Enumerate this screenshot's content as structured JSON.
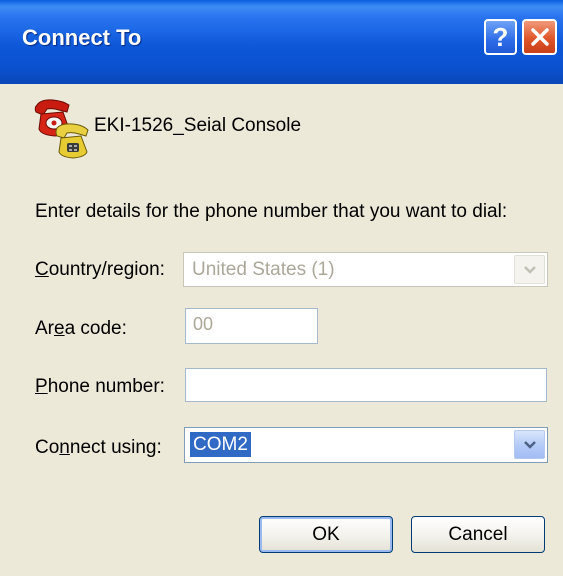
{
  "window": {
    "title": "Connect To",
    "help_glyph": "?",
    "title_icons": [
      "help-icon",
      "close-icon"
    ]
  },
  "connection": {
    "icon": "phone-icon",
    "name": "EKI-1526_Seial Console"
  },
  "instruction": "Enter details for the phone number that you want to dial:",
  "fields": {
    "country": {
      "label_prefix": "",
      "label_accel": "C",
      "label_suffix": "ountry/region:",
      "value": "United States (1)",
      "enabled": false
    },
    "area_code": {
      "label_prefix": "Ar",
      "label_accel": "e",
      "label_suffix": "a code:",
      "value": "00",
      "enabled": false
    },
    "phone_number": {
      "label_prefix": "",
      "label_accel": "P",
      "label_suffix": "hone number:",
      "value": "",
      "enabled": false
    },
    "connect_using": {
      "label_prefix": "Co",
      "label_accel": "n",
      "label_suffix": "nect using:",
      "value": "COM2",
      "enabled": true
    }
  },
  "buttons": {
    "ok": "OK",
    "cancel": "Cancel"
  },
  "colors": {
    "titlebar": "#0a51cf",
    "dialog_bg": "#ece9d8",
    "selection": "#316ac5",
    "close_button": "#e0562a"
  }
}
